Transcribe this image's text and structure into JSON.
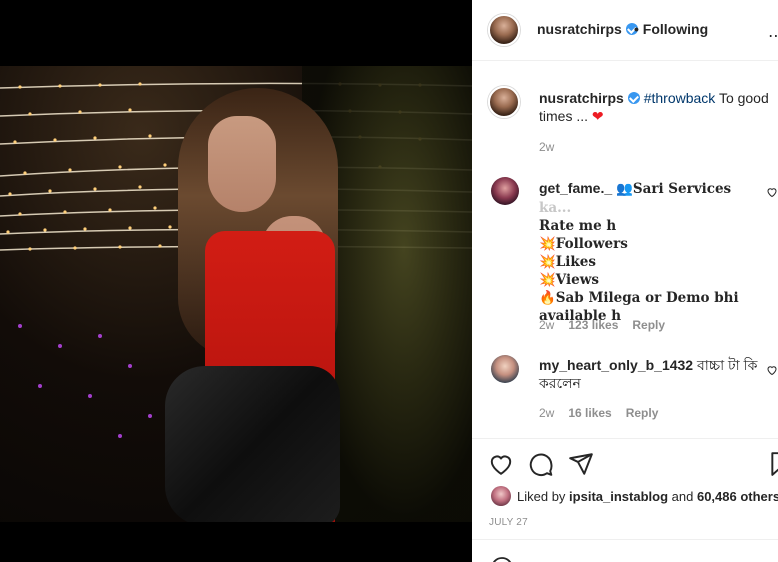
{
  "post": {
    "username": "nusratchirps",
    "follow_status": "Following",
    "separator": "•",
    "more_icon": "more-horizontal-icon"
  },
  "caption": {
    "username": "nusratchirps",
    "hashtag": "#throwback",
    "text": "To good times ...",
    "emoji": "❤",
    "age": "2w"
  },
  "comments": [
    {
      "username": "get_fame._",
      "emoji_lead": "👥",
      "line1": "Sari Services",
      "line1_faded": " ka...",
      "lines": [
        "Rate me h",
        "💥Followers",
        "💥Likes",
        "💥Views",
        "🔥Sab Milega or Demo bhi available h"
      ],
      "age": "2w",
      "likes": "123 likes",
      "reply": "Reply"
    },
    {
      "username": "my_heart_only_b_1432",
      "text": "বাচ্চা টা কি করলেন",
      "age": "2w",
      "likes": "16 likes",
      "reply": "Reply"
    }
  ],
  "actions": {
    "liked_by_prefix": "Liked by",
    "liked_by_user": "ipsita_instablog",
    "liked_by_mid": "and",
    "liked_by_count": "60,486 others",
    "date": "JULY 27"
  },
  "colors": {
    "verified": "#3897f0",
    "hashtag": "#00376b",
    "muted": "#8e8e8e",
    "text": "#262626",
    "heart": "#ed1c24"
  }
}
